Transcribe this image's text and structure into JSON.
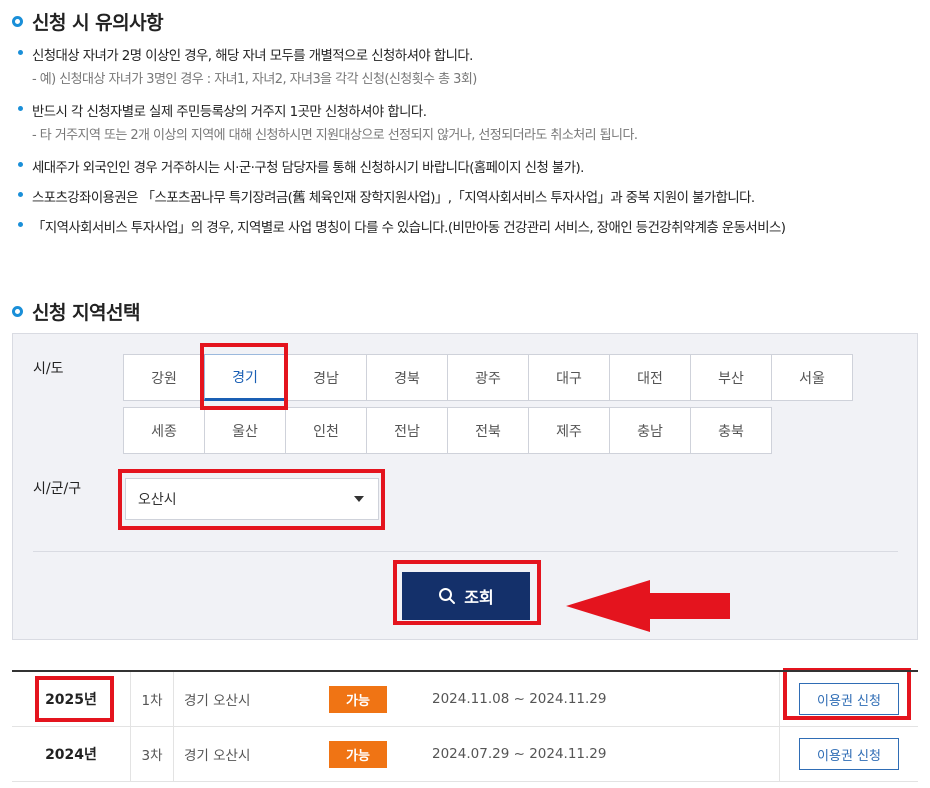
{
  "notice": {
    "title": "신청 시 유의사항",
    "items": [
      {
        "text": "신청대상 자녀가 2명 이상인 경우, 해당 자녀 모두를 개별적으로 신청하셔야 합니다.",
        "sub": "- 예) 신청대상 자녀가 3명인 경우 : 자녀1, 자녀2, 자녀3을 각각 신청(신청횟수 총 3회)"
      },
      {
        "text": "반드시 각 신청자별로 실제 주민등록상의 거주지 1곳만 신청하셔야 합니다.",
        "sub": "- 타 거주지역 또는 2개 이상의 지역에 대해 신청하시면 지원대상으로 선정되지 않거나, 선정되더라도 취소처리 됩니다."
      },
      {
        "text": "세대주가 외국인인 경우 거주하시는 시·군·구청 담당자를 통해 신청하시기 바랍니다(홈페이지 신청 불가)."
      },
      {
        "text": "스포츠강좌이용권은 「스포츠꿈나무 특기장려금(舊 체육인재 장학지원사업)」,「지역사회서비스 투자사업」과 중복 지원이 불가합니다."
      },
      {
        "text": "「지역사회서비스 투자사업」의 경우, 지역별로 사업 명칭이 다를 수 있습니다.(비만아동 건강관리 서비스, 장애인 등건강취약계층 운동서비스)"
      }
    ]
  },
  "region": {
    "title": "신청 지역선택",
    "sido_label": "시/도",
    "sigungu_label": "시/군/구",
    "sido_options": [
      "강원",
      "경기",
      "경남",
      "경북",
      "광주",
      "대구",
      "대전",
      "부산",
      "서울",
      "세종",
      "울산",
      "인천",
      "전남",
      "전북",
      "제주",
      "충남",
      "충북"
    ],
    "selected_sido": "경기",
    "sigungu_value": "오산시",
    "search_label": "조회"
  },
  "results": {
    "rows": [
      {
        "year": "2025년",
        "round": "1차",
        "region": "경기 오산시",
        "status": "가능",
        "period": "2024.11.08 ~ 2024.11.29",
        "action": "이용권 신청"
      },
      {
        "year": "2024년",
        "round": "3차",
        "region": "경기 오산시",
        "status": "가능",
        "period": "2024.07.29 ~ 2024.11.29",
        "action": "이용권 신청"
      }
    ]
  },
  "colors": {
    "accent": "#1a8fd8",
    "primary_button": "#14306a",
    "status_badge": "#f07414",
    "highlight": "#e4141e",
    "link_button": "#2f6db5"
  }
}
